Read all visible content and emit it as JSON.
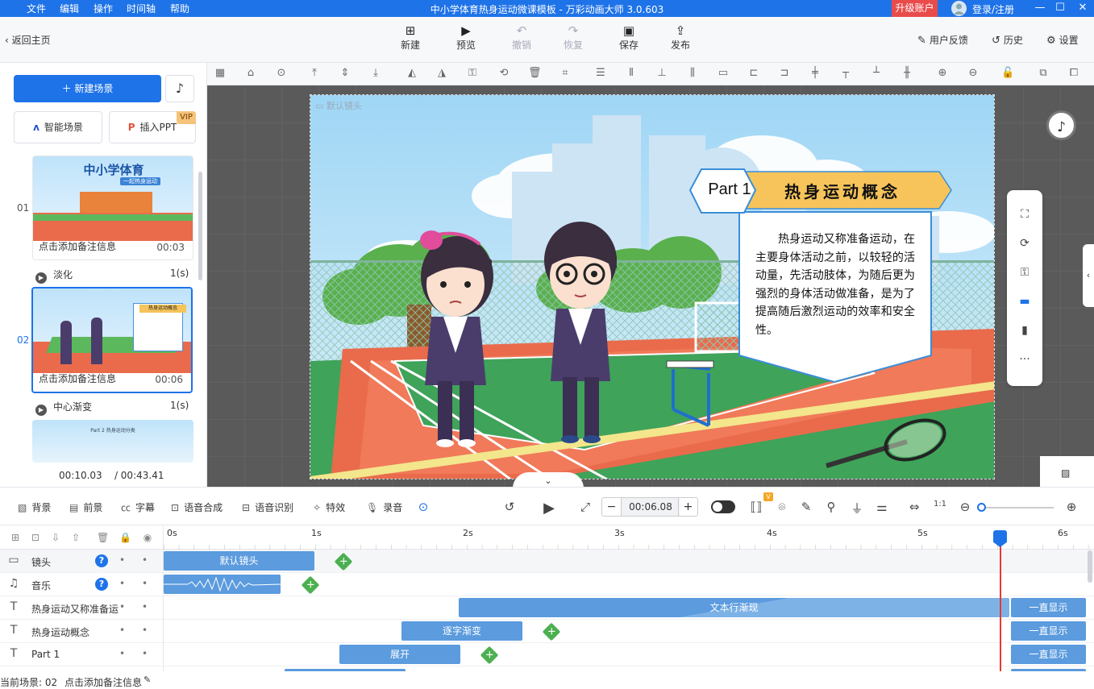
{
  "titlebar": {
    "menus": [
      "文件",
      "编辑",
      "操作",
      "时间轴",
      "帮助"
    ],
    "title": "中小学体育热身运动微课模板 - 万彩动画大师 3.0.603",
    "upgrade": "升级账户",
    "login": "登录/注册"
  },
  "toolbar": {
    "back": "返回主页",
    "new": "新建",
    "preview": "预览",
    "undo": "撤销",
    "redo": "恢复",
    "save": "保存",
    "publish": "发布",
    "feedback": "用户反馈",
    "history": "历史",
    "settings": "设置"
  },
  "left": {
    "new_scene": "新建场景",
    "smart_scene": "智能场景",
    "insert_ppt": "插入PPT",
    "vip": "VIP",
    "scenes": [
      {
        "num": "01",
        "thumb_title": "中小学体育",
        "thumb_sub": "一起热身运动",
        "note": "点击添加备注信息",
        "dur": "00:03",
        "transition": "淡化",
        "trans_time": "1(s)"
      },
      {
        "num": "02",
        "thumb_title": "热身运动概念",
        "note": "点击添加备注信息",
        "dur": "00:06",
        "transition": "中心渐变",
        "trans_time": "1(s)"
      },
      {
        "num": "03",
        "thumb_title": "Part 2  热身运动分类"
      }
    ],
    "current_time": "00:10.03",
    "total_time": "/ 00:43.41"
  },
  "stage": {
    "camera_label": "默认镜头",
    "part_label": "Part 1",
    "heading": "热身运动概念",
    "body": "热身运动又称准备运动，在主要身体活动之前，以较轻的活动量，先活动肢体，为随后更为强烈的身体活动做准备，是为了提高随后激烈运动的效率和安全性。"
  },
  "bottombar": {
    "background": "背景",
    "foreground": "前景",
    "subtitle": "字幕",
    "tts": "语音合成",
    "asr": "语音识别",
    "effects": "特效",
    "record": "录音",
    "time_value": "00:06.08",
    "v_badge": "V"
  },
  "timeline": {
    "ticks": [
      "0s",
      "1s",
      "2s",
      "3s",
      "4s",
      "5s",
      "6s"
    ],
    "rows": [
      {
        "name": "镜头",
        "clip": "默认镜头"
      },
      {
        "name": "音乐"
      },
      {
        "name": "热身运动又称准备运动",
        "clip": "文本行渐现",
        "end": "一直显示"
      },
      {
        "name": "热身运动概念",
        "clip": "逐字渐变",
        "end": "一直显示"
      },
      {
        "name": "Part 1",
        "clip": "展开",
        "end": "一直显示"
      }
    ]
  },
  "status": {
    "scene": "当前场景: 02",
    "note": "点击添加备注信息"
  },
  "colors": {
    "primary": "#1e73e8",
    "upgrade": "#e94b4b",
    "clip": "#5b9bde",
    "add": "#4caf50",
    "playhead": "#e53935"
  }
}
